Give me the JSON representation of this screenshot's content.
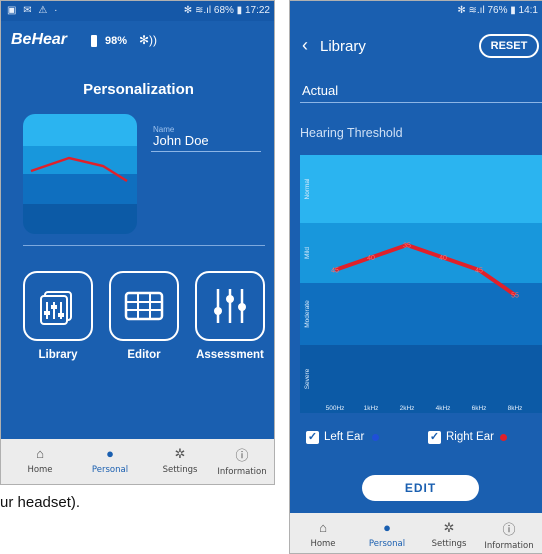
{
  "screen1": {
    "status": {
      "left_icons": "▣ ✉ ⚠ ·",
      "right": "✻ ≋.ıl 68% ▮ 17:22"
    },
    "header": {
      "brand": "BeHear",
      "battery": "98%",
      "bluetooth_icon": "bluetooth-icon"
    },
    "title": "Personalization",
    "profile": {
      "name_label": "Name",
      "name_value": "John Doe"
    },
    "tiles": [
      {
        "label": "Library",
        "icon": "library-icon"
      },
      {
        "label": "Editor",
        "icon": "grid-icon"
      },
      {
        "label": "Assessment",
        "icon": "sliders-icon"
      }
    ],
    "nav": [
      {
        "label": "Home",
        "icon": "home-icon"
      },
      {
        "label": "Personal",
        "icon": "person-icon",
        "active": true
      },
      {
        "label": "Settings",
        "icon": "gear-icon"
      },
      {
        "label": "Information",
        "icon": "info-icon"
      }
    ]
  },
  "caption": "ur headset).",
  "screen2": {
    "status": {
      "right": "✻ ≋.ıl 76% ▮ 14:1"
    },
    "header": {
      "back_icon": "back-icon",
      "title": "Library",
      "reset": "RESET"
    },
    "actual": "Actual",
    "hearing_title": "Hearing Threshold",
    "left_ear": "Left Ear",
    "right_ear": "Right Ear",
    "edit": "EDIT",
    "nav": [
      {
        "label": "Home",
        "icon": "home-icon"
      },
      {
        "label": "Personal",
        "icon": "person-icon",
        "active": true
      },
      {
        "label": "Settings",
        "icon": "gear-icon"
      },
      {
        "label": "Information",
        "icon": "info-icon"
      }
    ]
  },
  "chart_data": {
    "type": "line",
    "title": "Hearing Threshold",
    "bands": [
      "Normal",
      "Mild",
      "Moderate",
      "Severe"
    ],
    "band_colors": [
      "#2bb4f0",
      "#1897dc",
      "#0f6fbf",
      "#0c5aa6"
    ],
    "categories": [
      "500Hz",
      "1kHz",
      "2kHz",
      "4kHz",
      "6kHz",
      "8kHz"
    ],
    "series": [
      {
        "values": [
          45,
          40,
          35,
          40,
          45,
          55
        ],
        "color": "#e0202a"
      }
    ],
    "colors": {
      "right_ear": "#e0202a",
      "left_ear": "#1f4fd8"
    }
  }
}
